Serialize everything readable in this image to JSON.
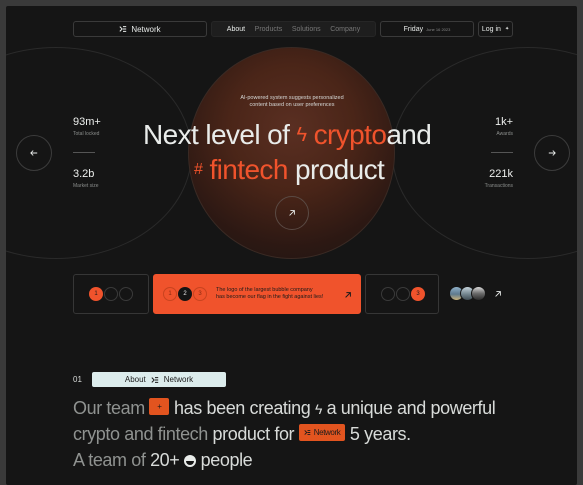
{
  "brand": {
    "name": "Network",
    "logo_icon": "network-logo-icon"
  },
  "nav": {
    "items": [
      {
        "label": "About",
        "active": true
      },
      {
        "label": "Products",
        "active": false
      },
      {
        "label": "Solutions",
        "active": false
      },
      {
        "label": "Company",
        "active": false
      }
    ]
  },
  "date": {
    "day": "Friday",
    "full": "June 16 2023"
  },
  "login": {
    "label": "Log in",
    "icon": "sparkle-icon"
  },
  "hero": {
    "tagline": [
      "AI-powered system suggests personalized",
      "content based on user preferences"
    ],
    "line1": {
      "pre": "Next level of",
      "accent": "crypto",
      "post": "and",
      "icon": "lightning-icon"
    },
    "line2": {
      "accent": "fintech",
      "post": "product",
      "icon": "hash-icon"
    },
    "arrow_icon": "arrow-up-right-icon"
  },
  "stats": {
    "left": [
      {
        "value": "93m+",
        "label": "Total locked"
      },
      {
        "value": "3.2b",
        "label": "Market size"
      }
    ],
    "right": [
      {
        "value": "1k+",
        "label": "Awards"
      },
      {
        "value": "221k",
        "label": "Transactions"
      }
    ]
  },
  "slider": {
    "cards": [
      {
        "number": "1"
      },
      {
        "numbers": [
          "1",
          "2",
          "3"
        ],
        "text": [
          "The logo of the largest bubble company",
          "has become our flag in the fight against lies!"
        ]
      },
      {
        "number": "3"
      }
    ],
    "prev_icon": "arrow-left-icon",
    "next_icon": "arrow-right-icon"
  },
  "about": {
    "index": "01",
    "pill_label": "About",
    "pill_brand": "Network",
    "line1": {
      "a": "Our team",
      "tag": "+",
      "b": "has been creating",
      "icon": "lightning-icon",
      "c": "a unique and powerful"
    },
    "line2": {
      "a": "crypto and fintech",
      "b": "product for",
      "tag": "Network",
      "c": "5 years."
    },
    "line3": {
      "a": "A team of",
      "b": "20+",
      "icon": "smile-icon",
      "c": "people"
    }
  },
  "colors": {
    "accent": "#f0532c",
    "background": "#151515",
    "text": "#e9ecea"
  }
}
